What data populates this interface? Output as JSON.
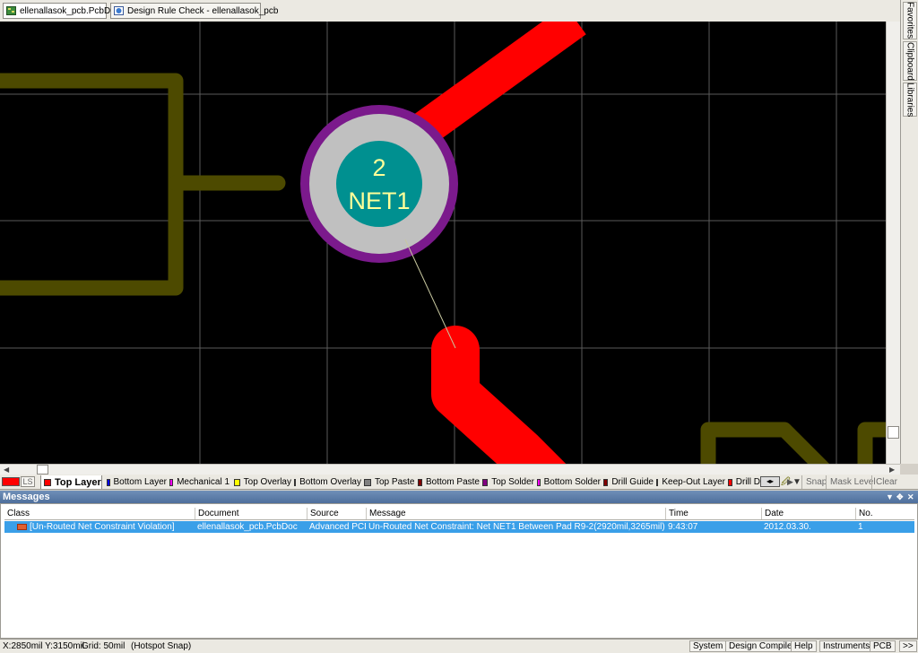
{
  "tabs": [
    {
      "label": "ellenallasok_pcb.PcbDoc",
      "icon": "pcb-document-icon",
      "active": true
    },
    {
      "label": "Design Rule Check - ellenallasok_pcb",
      "icon": "drc-report-icon",
      "active": false
    }
  ],
  "side_panels": [
    "Favorites",
    "Clipboard",
    "Libraries"
  ],
  "canvas": {
    "pad_number": "2",
    "pad_net": "NET1",
    "colors": {
      "background": "#000000",
      "grid": "#5a5a5a",
      "track": "#ff0000",
      "overlay": "#4d4a00",
      "pad_ring": "#c0c0c0",
      "pad_mask": "#7b1a8c",
      "pad_hole": "#009090",
      "pad_text": "#ffff99",
      "ratsnest": "#c8c8a0"
    }
  },
  "current_layer": {
    "color": "#ff0000",
    "ls_label": "LS"
  },
  "layers": [
    {
      "name": "Top Layer",
      "color": "#ff0000",
      "active": true
    },
    {
      "name": "Bottom Layer",
      "color": "#0000ff"
    },
    {
      "name": "Mechanical 1",
      "color": "#ff00ff"
    },
    {
      "name": "Top Overlay",
      "color": "#ffff00"
    },
    {
      "name": "Bottom Overlay",
      "color": "#808000"
    },
    {
      "name": "Top Paste",
      "color": "#808080"
    },
    {
      "name": "Bottom Paste",
      "color": "#800000"
    },
    {
      "name": "Top Solder",
      "color": "#800080"
    },
    {
      "name": "Bottom Solder",
      "color": "#ff00ff"
    },
    {
      "name": "Drill Guide",
      "color": "#800000"
    },
    {
      "name": "Keep-Out Layer",
      "color": "#ff00ff"
    },
    {
      "name": "Drill D",
      "color": "#ff0000"
    }
  ],
  "layer_controls": {
    "snap": "Snap",
    "mask_level": "Mask Level",
    "clear": "Clear"
  },
  "messages": {
    "title": "Messages",
    "columns": [
      "Class",
      "Document",
      "Source",
      "Message",
      "Time",
      "Date",
      "No."
    ],
    "rows": [
      {
        "class": "[Un-Routed Net Constraint Violation]",
        "document": "ellenallasok_pcb.PcbDoc",
        "source": "Advanced PCB",
        "message": "Un-Routed Net Constraint: Net NET1 Between Pad R9-2(2920mil,3265mil)  Multi-Laye...",
        "time": "9:43:07",
        "date": "2012.03.30.",
        "no": "1"
      }
    ]
  },
  "status": {
    "coords": "X:2850mil Y:3150mil",
    "grid": "Grid: 50mil",
    "snap": "(Hotspot Snap)",
    "buttons": [
      "System",
      "Design Compiler",
      "Help",
      "Instruments",
      "PCB",
      ">>"
    ]
  }
}
